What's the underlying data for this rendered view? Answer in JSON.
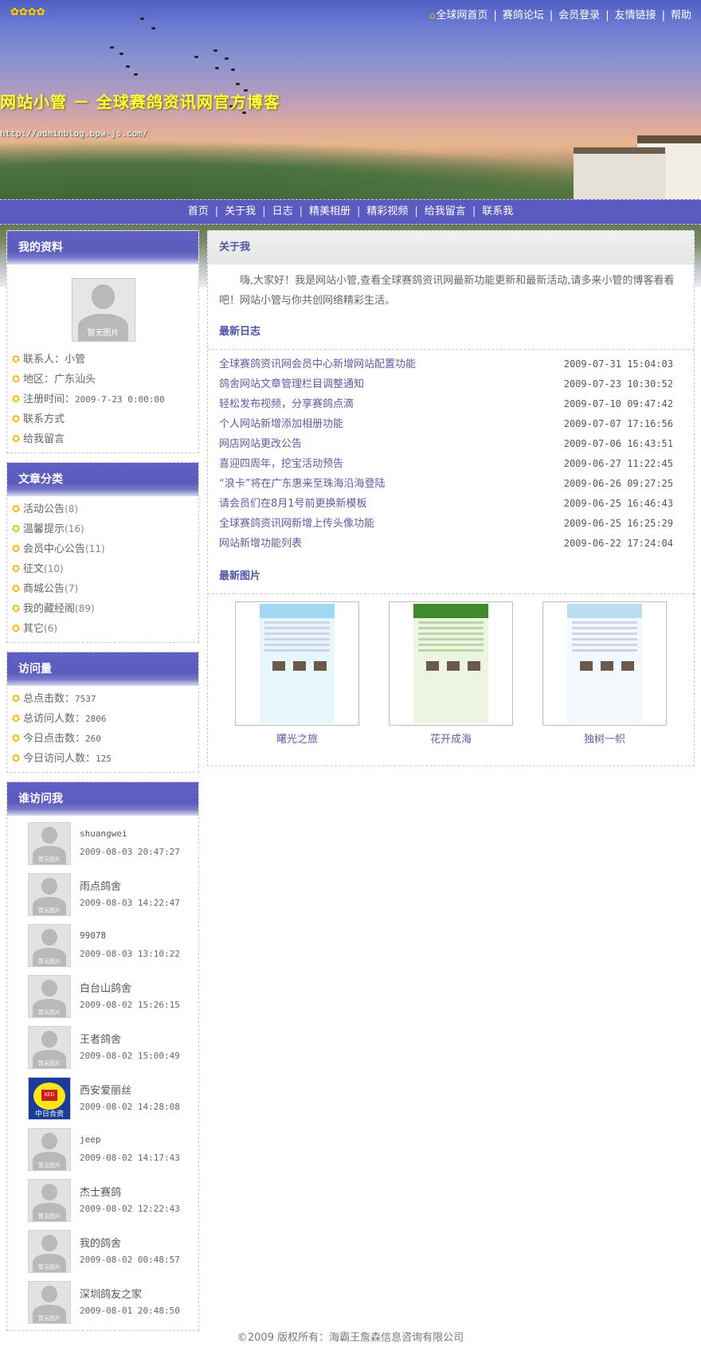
{
  "header": {
    "site_title": "网站小管 － 全球赛鸽资讯网官方博客",
    "site_url": "http://adminblog.bpw-js.com/",
    "top_links": [
      "全球网首页",
      "赛鸽论坛",
      "会员登录",
      "友情链接",
      "帮助"
    ]
  },
  "nav": [
    "首页",
    "关于我",
    "日志",
    "精美相册",
    "精彩视频",
    "给我留言",
    "联系我"
  ],
  "profile": {
    "title": "我的资料",
    "avatar_caption": "暂无图片",
    "contact_label": "联系人：",
    "contact_value": "小管",
    "region_label": "地区：",
    "region_value": "广东汕头",
    "regtime_label": "注册时间：",
    "regtime_value": "2009-7-23 0:00:00",
    "contact_method": "联系方式",
    "leave_message": "给我留言"
  },
  "categories": {
    "title": "文章分类",
    "items": [
      {
        "name": "活动公告",
        "count": "(8)"
      },
      {
        "name": "温馨提示",
        "count": "(16)"
      },
      {
        "name": "会员中心公告",
        "count": "(11)"
      },
      {
        "name": "征文",
        "count": "(10)"
      },
      {
        "name": "商城公告",
        "count": "(7)"
      },
      {
        "name": "我的藏经阁",
        "count": "(89)"
      },
      {
        "name": "其它",
        "count": "(6)"
      }
    ]
  },
  "visits": {
    "title": "访问量",
    "items": [
      {
        "label": "总点击数：",
        "value": "7537"
      },
      {
        "label": "总访问人数：",
        "value": "2806"
      },
      {
        "label": "今日点击数：",
        "value": "260"
      },
      {
        "label": "今日访问人数：",
        "value": "125"
      }
    ]
  },
  "visitors": {
    "title": "谁访问我",
    "avatar_caption": "暂无图片",
    "logo_caption": "中日合资",
    "logo_text": "KED",
    "items": [
      {
        "name": "shuangwei",
        "time": "2009-08-03 20:47:27"
      },
      {
        "name": "雨点鸽舍",
        "time": "2009-08-03 14:22:47"
      },
      {
        "name": "99078",
        "time": "2009-08-03 13:10:22"
      },
      {
        "name": "白台山鸽舍",
        "time": "2009-08-02 15:26:15"
      },
      {
        "name": "王者鸽舍",
        "time": "2009-08-02 15:00:49"
      },
      {
        "name": "西安爱丽丝",
        "time": "2009-08-02 14:28:08"
      },
      {
        "name": "jeep",
        "time": "2009-08-02 14:17:43"
      },
      {
        "name": "杰士赛鸽",
        "time": "2009-08-02 12:22:43"
      },
      {
        "name": "我的鸽舍",
        "time": "2009-08-02 00:48:57"
      },
      {
        "name": "深圳鸽友之家",
        "time": "2009-08-01 20:48:50"
      }
    ]
  },
  "about": {
    "title": "关于我",
    "text": "嗨,大家好！我是网站小管,查看全球赛鸽资讯网最新功能更新和最新活动,请多来小管的博客看看吧！网站小管与你共创网络精彩生活。"
  },
  "latest_logs": {
    "title": "最新日志",
    "items": [
      {
        "title": "全球赛鸽资讯网会员中心新增网站配置功能",
        "date": "2009-07-31 15:04:03"
      },
      {
        "title": "鸽舍网站文章管理栏目调整通知",
        "date": "2009-07-23 10:30:52"
      },
      {
        "title": "轻松发布视频，分享赛鸽点滴",
        "date": "2009-07-10 09:47:42"
      },
      {
        "title": "个人网站新增添加相册功能",
        "date": "2009-07-07 17:16:56"
      },
      {
        "title": "网店网站更改公告",
        "date": "2009-07-06 16:43:51"
      },
      {
        "title": "喜迎四周年，挖宝活动预告",
        "date": "2009-06-27 11:22:45"
      },
      {
        "title": "“浪卡”将在广东惠来至珠海沿海登陆",
        "date": "2009-06-26 09:27:25"
      },
      {
        "title": "请会员们在8月1号前更换新模板",
        "date": "2009-06-25 16:46:43"
      },
      {
        "title": "全球赛鸽资讯网新增上传头像功能",
        "date": "2009-06-25 16:25:29"
      },
      {
        "title": "网站新增功能列表",
        "date": "2009-06-22 17:24:04"
      }
    ]
  },
  "latest_pics": {
    "title": "最新图片",
    "items": [
      {
        "label": "曙光之旅",
        "theme": "#9fd8f0"
      },
      {
        "label": "花开成海",
        "theme": "#3f8a2a"
      },
      {
        "label": "独树一帜",
        "theme": "#b8def0"
      }
    ]
  },
  "footer": "©2009 版权所有：海霸王詹森信息咨询有限公司",
  "colors": {
    "accent": "#5b5ac0",
    "title_yellow": "#ffff3d",
    "link": "#5d5ca4"
  }
}
